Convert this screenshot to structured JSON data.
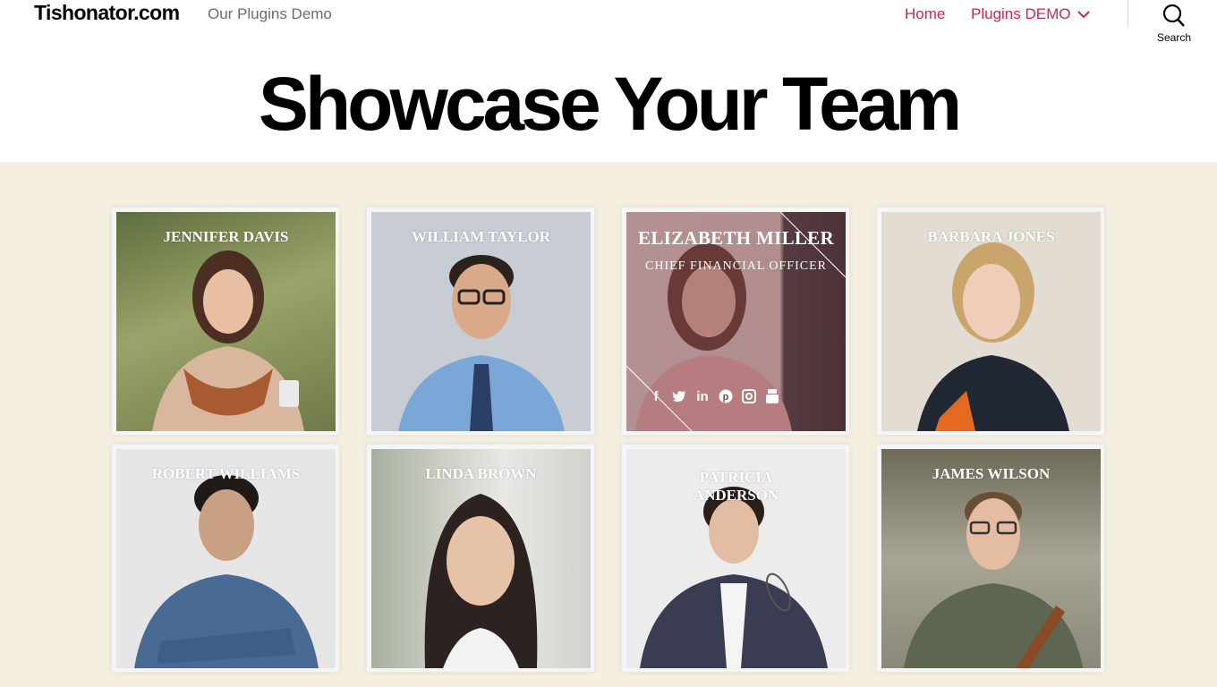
{
  "header": {
    "site_title": "Tishonator.com",
    "site_description": "Our Plugins Demo",
    "nav": [
      {
        "label": "Home"
      },
      {
        "label": "Plugins DEMO"
      }
    ],
    "search_label": "Search"
  },
  "page": {
    "title": "Showcase Your Team"
  },
  "team": {
    "members": [
      {
        "name": "JENNIFER DAVIS",
        "bg": "#7d8a5c"
      },
      {
        "name": "WILLIAM TAYLOR",
        "bg": "#c7ccd3"
      },
      {
        "name": "ELIZABETH MILLER",
        "role": "CHIEF FINANCIAL OFFICER",
        "bg": "#8d6b6b"
      },
      {
        "name": "BARBARA JONES",
        "bg": "#e1dbd3"
      },
      {
        "name": "ROBERT WILLIAMS",
        "bg": "#e6e6e6"
      },
      {
        "name": "LINDA BROWN",
        "bg": "#c9c9c4"
      },
      {
        "name": "PATRICIA ANDERSON",
        "bg": "#ececec"
      },
      {
        "name": "JAMES WILSON",
        "bg": "#8d8a7a"
      }
    ],
    "social_icons": [
      "facebook-icon",
      "twitter-icon",
      "linkedin-icon",
      "pinterest-icon",
      "instagram-icon",
      "youtube-icon"
    ]
  },
  "colors": {
    "accent": "#cd2653",
    "section_bg": "#f5efe0"
  }
}
